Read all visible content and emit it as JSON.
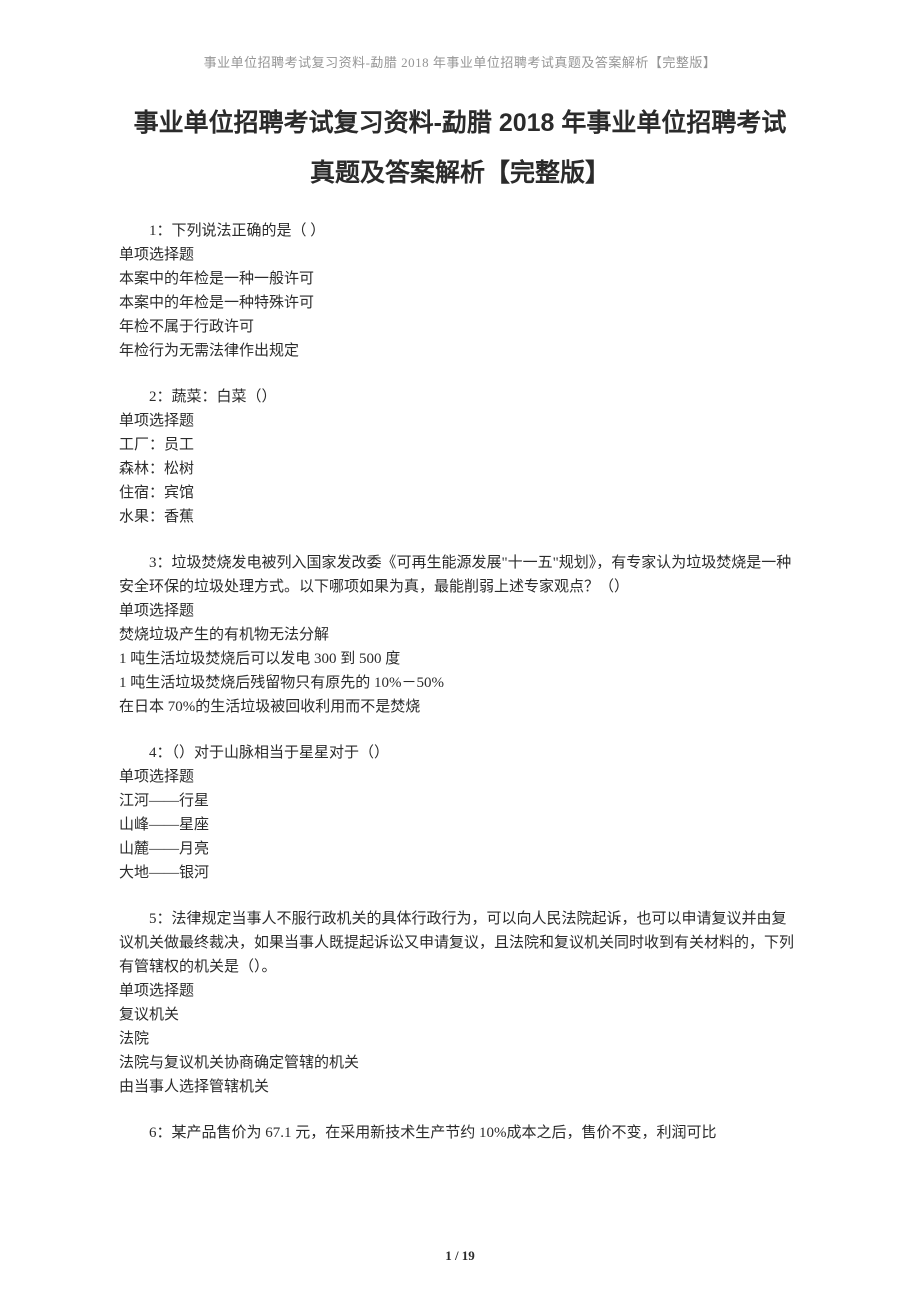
{
  "header": {
    "text": "事业单位招聘考试复习资料-勐腊 2018 年事业单位招聘考试真题及答案解析【完整版】"
  },
  "title": {
    "line1": "事业单位招聘考试复习资料-勐腊 2018 年事业单位招聘考试",
    "line2": "真题及答案解析【完整版】"
  },
  "questions": [
    {
      "stem": "1：下列说法正确的是（ ）",
      "type": "单项选择题",
      "options": [
        "本案中的年检是一种一般许可",
        "本案中的年检是一种特殊许可",
        "年检不属于行政许可",
        "年检行为无需法律作出规定"
      ]
    },
    {
      "stem": "2：蔬菜：白菜（）",
      "type": "单项选择题",
      "options": [
        "工厂：员工",
        "森林：松树",
        "住宿：宾馆",
        "水果：香蕉"
      ]
    },
    {
      "stem": "3：垃圾焚烧发电被列入国家发改委《可再生能源发展\"十一五\"规划》，有专家认为垃圾焚烧是一种安全环保的垃圾处理方式。以下哪项如果为真，最能削弱上述专家观点？（）",
      "type": "单项选择题",
      "options": [
        "焚烧垃圾产生的有机物无法分解",
        "1 吨生活垃圾焚烧后可以发电 300 到 500 度",
        "1 吨生活垃圾焚烧后残留物只有原先的 10%－50%",
        "在日本 70%的生活垃圾被回收利用而不是焚烧"
      ]
    },
    {
      "stem": "4：（）对于山脉相当于星星对于（）",
      "type": "单项选择题",
      "options": [
        "江河——行星",
        "山峰——星座",
        "山麓——月亮",
        "大地——银河"
      ]
    },
    {
      "stem": "5：法律规定当事人不服行政机关的具体行政行为，可以向人民法院起诉，也可以申请复议并由复议机关做最终裁决，如果当事人既提起诉讼又申请复议，且法院和复议机关同时收到有关材料的，下列有管辖权的机关是（）。",
      "type": "单项选择题",
      "options": [
        "复议机关",
        "法院",
        "法院与复议机关协商确定管辖的机关",
        "由当事人选择管辖机关"
      ]
    },
    {
      "stem": "6：某产品售价为 67.1 元，在采用新技术生产节约 10%成本之后，售价不变，利润可比",
      "type": "",
      "options": []
    }
  ],
  "footer": {
    "pageInfo": "1 / 19"
  }
}
